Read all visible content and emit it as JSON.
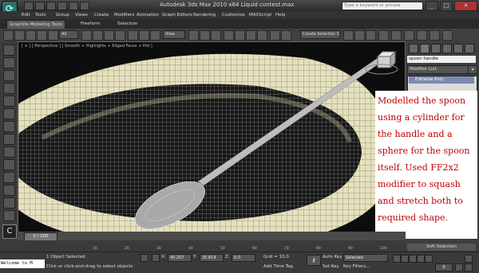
{
  "title": "Autodesk 3ds Max  2010 x64    Liquid contest.max",
  "search_placeholder": "Type a keyword or phrase",
  "menu": [
    "Edit",
    "Tools",
    "Group",
    "Views",
    "Create",
    "Modifiers",
    "Animation",
    "Graph Editors",
    "Rendering",
    "Customize",
    "MAXScript",
    "Help"
  ],
  "ribbon": {
    "tabs": [
      "Graphite Modeling Tools",
      "Freeform",
      "Selection"
    ]
  },
  "toolbar": {
    "filter": "All",
    "ref_coord": "View",
    "named_sel": "Create Selection S"
  },
  "viewport": {
    "label": "[ + ] [ Perspective ] [ Smooth + Highlights + Edged Faces + Hid ]"
  },
  "command_panel": {
    "object_name": "spoon handle",
    "modifier_list": "Modifier List",
    "stack_item": "Editable Poly",
    "soft_selection": "Soft Selection"
  },
  "annotation": "Modelled the spoon using a cylinder for the handle and a sphere for the spoon itself. Used FF2x2 modifier to squash and stretch both to required shape.",
  "timeline": {
    "frame": "0 / 100",
    "ticks": [
      "10",
      "20",
      "30",
      "40",
      "50",
      "60",
      "70",
      "80",
      "90",
      "100"
    ]
  },
  "status": {
    "maxscript": "Welcome to M",
    "selected": "1 Object Selected",
    "prompt": "Click or click-and-drag to select objects",
    "x_label": "X:",
    "x": "40.207",
    "y_label": "Y:",
    "y": "35.814",
    "z_label": "Z:",
    "z": "0.0",
    "grid": "Grid = 10.0",
    "add_time_tag": "Add Time Tag",
    "auto_key": "Auto Key",
    "set_key": "Set Key",
    "selected_dd": "Selected",
    "key_filters": "Key Filters...",
    "frame": "0"
  }
}
